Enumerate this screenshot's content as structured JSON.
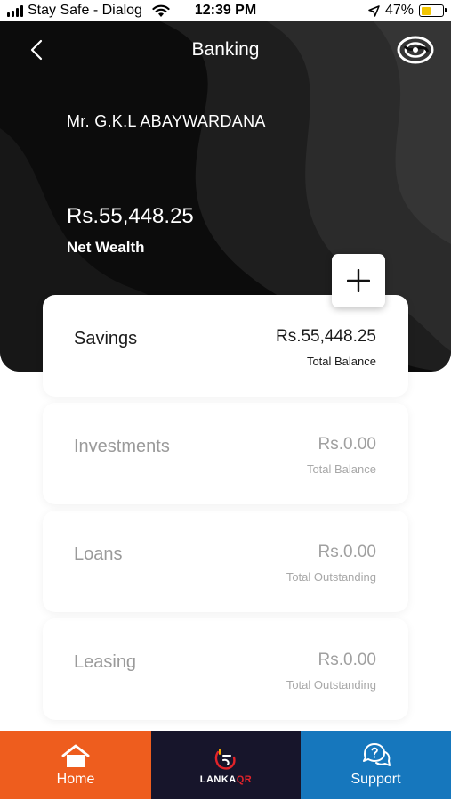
{
  "status_bar": {
    "carrier": "Stay Safe - Dialog",
    "time": "12:39 PM",
    "battery_percent": "47%",
    "battery_level": 0.47,
    "battery_color": "#f2c500"
  },
  "header": {
    "title": "Banking",
    "back_icon": "chevron-left-icon",
    "logo_icon": "bank-logo-icon"
  },
  "summary": {
    "holder_name": "Mr. G.K.L ABAYWARDANA",
    "net_wealth_amount": "Rs.55,448.25",
    "net_wealth_label": "Net Wealth"
  },
  "add_button_icon": "plus-icon",
  "accounts": [
    {
      "title": "Savings",
      "amount": "Rs.55,448.25",
      "subtitle": "Total Balance"
    },
    {
      "title": "Investments",
      "amount": "Rs.0.00",
      "subtitle": "Total Balance"
    },
    {
      "title": "Loans",
      "amount": "Rs.0.00",
      "subtitle": "Total Outstanding"
    },
    {
      "title": "Leasing",
      "amount": "Rs.0.00",
      "subtitle": "Total Outstanding"
    }
  ],
  "bottom_nav": {
    "home": {
      "label": "Home",
      "icon": "home-icon",
      "color": "#ee5d1e"
    },
    "qr": {
      "label_main": "LANKA",
      "label_accent": "QR",
      "icon": "lankaqr-logo-icon",
      "color": "#17152b"
    },
    "support": {
      "label": "Support",
      "icon": "support-chat-icon",
      "color": "#1677bd"
    }
  }
}
